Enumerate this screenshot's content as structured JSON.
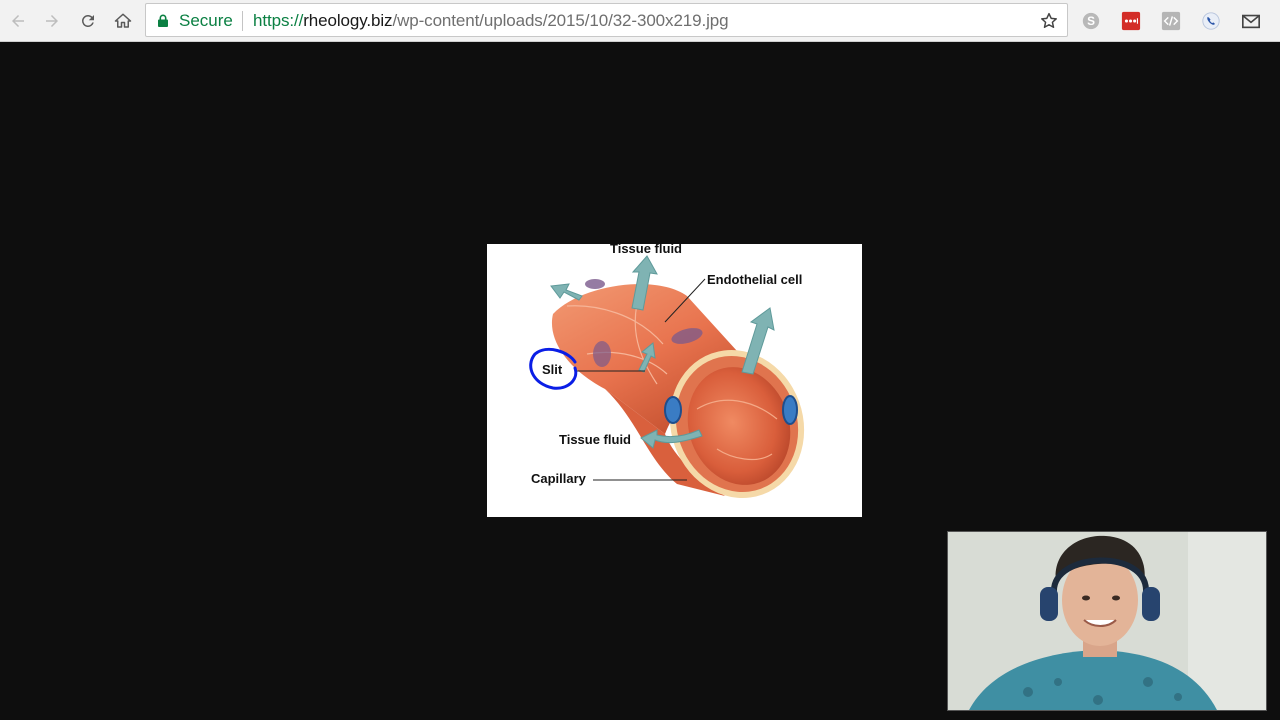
{
  "browser": {
    "omnibox": {
      "secure_label": "Secure",
      "url_scheme": "https://",
      "url_host": "rheology.biz",
      "url_path": "/wp-content/uploads/2015/10/32-300x219.jpg"
    },
    "extensions": [
      "skype-icon",
      "lastpass-icon",
      "code-icon",
      "phone-icon",
      "gmail-icon"
    ]
  },
  "figure": {
    "labels": {
      "tissue_fluid_top": "Tissue fluid",
      "endothelial_cell": "Endothelial cell",
      "slit": "Slit",
      "tissue_fluid_bottom": "Tissue fluid",
      "capillary": "Capillary"
    },
    "annotation_color": "#0a1ee6"
  },
  "colors": {
    "secure_green": "#0b8043",
    "capillary_orange": "#e8734e",
    "arrow_teal": "#7fb3b3"
  }
}
